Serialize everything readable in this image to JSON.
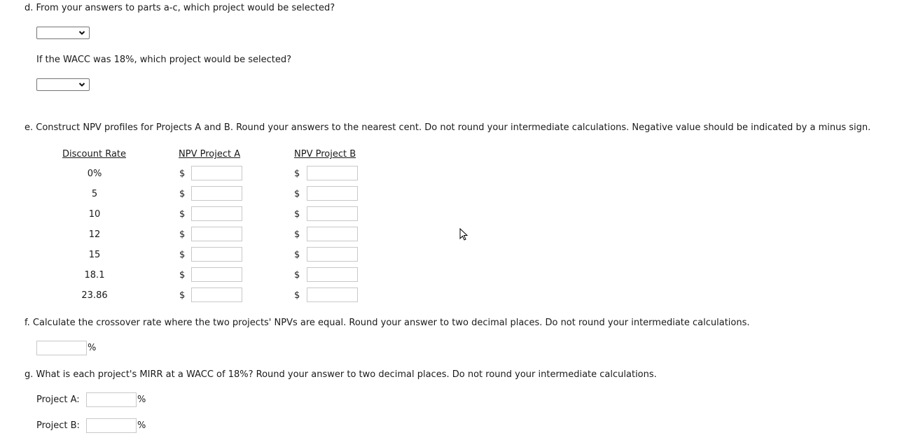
{
  "part_d": {
    "question": "d. From your answers to parts a-c, which project would be selected?",
    "select1": {
      "selected": "",
      "icon": "chevron-down-icon"
    },
    "followup": "If the WACC was 18%, which project would be selected?",
    "select2": {
      "selected": "",
      "icon": "chevron-down-icon"
    }
  },
  "part_e": {
    "question": "e. Construct NPV profiles for Projects A and B. Round your answers to the nearest cent. Do not round your intermediate calculations. Negative value should be indicated by a minus sign.",
    "headers": {
      "rate": "Discount Rate",
      "npv_a": "NPV Project A",
      "npv_b": "NPV Project B"
    },
    "currency_symbol": "$",
    "rows": [
      {
        "rate": "0%",
        "npv_a": "",
        "npv_b": ""
      },
      {
        "rate": "5",
        "npv_a": "",
        "npv_b": ""
      },
      {
        "rate": "10",
        "npv_a": "",
        "npv_b": ""
      },
      {
        "rate": "12",
        "npv_a": "",
        "npv_b": ""
      },
      {
        "rate": "15",
        "npv_a": "",
        "npv_b": ""
      },
      {
        "rate": "18.1",
        "npv_a": "",
        "npv_b": ""
      },
      {
        "rate": "23.86",
        "npv_a": "",
        "npv_b": ""
      }
    ]
  },
  "part_f": {
    "question": "f. Calculate the crossover rate where the two projects' NPVs are equal. Round your answer to two decimal places. Do not round your intermediate calculations.",
    "value": "",
    "unit": "%"
  },
  "part_g": {
    "question": "g. What is each project's MIRR at a WACC of 18%? Round your answer to two decimal places. Do not round your intermediate calculations.",
    "project_a": {
      "label": "Project A:",
      "value": "",
      "unit": "%"
    },
    "project_b": {
      "label": "Project B:",
      "value": "",
      "unit": "%"
    }
  },
  "cursor": {
    "icon": "mouse-pointer-icon"
  }
}
